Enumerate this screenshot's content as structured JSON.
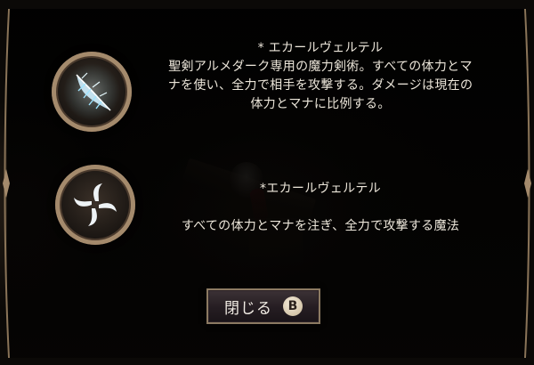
{
  "skills": [
    {
      "icon": "feather-blade-icon",
      "name": "* エカールヴェルテル",
      "description_lines": [
        "聖剣アルメダーク専用の魔力剣術。すべての体力とマ",
        "ナを使い、全力で相手を攻撃する。ダメージは現在の",
        "体力とマナに比例する。"
      ]
    },
    {
      "icon": "four-blade-shuriken-icon",
      "name": "*エカールヴェルテル",
      "description_lines": [
        "すべての体力とマナを注ぎ、全力で攻撃する魔法"
      ]
    }
  ],
  "close_button": {
    "label": "閉じる",
    "key_glyph": "B"
  },
  "colors": {
    "panel": "#0b0907",
    "frame_accent": "#a48a6c",
    "text": "#ece6da"
  }
}
